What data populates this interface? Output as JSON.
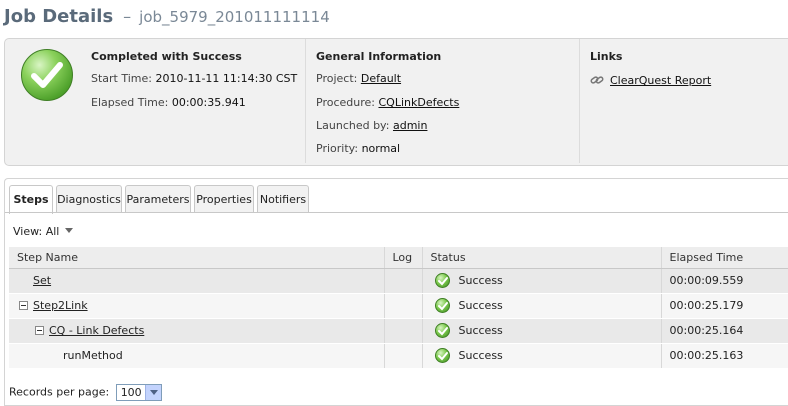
{
  "header": {
    "title": "Job Details",
    "separator": "–",
    "job_name": "job_5979_201011111114"
  },
  "summary": {
    "status_title": "Completed with Success",
    "start_label": "Start Time:",
    "start_value": "2010-11-11 11:14:30 CST",
    "elapsed_label": "Elapsed Time:",
    "elapsed_value": "00:00:35.941",
    "general_title": "General Information",
    "project_label": "Project:",
    "project_value": "Default",
    "procedure_label": "Procedure:",
    "procedure_value": "CQLinkDefects",
    "launched_label": "Launched by:",
    "launched_value": "admin",
    "priority_label": "Priority:",
    "priority_value": "normal",
    "links_title": "Links",
    "link_text": "ClearQuest Report"
  },
  "tabs": [
    "Steps",
    "Diagnostics",
    "Parameters",
    "Properties",
    "Notifiers"
  ],
  "active_tab": "Steps",
  "view": {
    "label": "View:",
    "value": "All"
  },
  "table": {
    "columns": [
      "Step Name",
      "Log",
      "Status",
      "Elapsed Time"
    ],
    "rows": [
      {
        "name": "Set",
        "log": "",
        "status": "Success",
        "elapsed": "00:00:09.559"
      },
      {
        "name": "Step2Link",
        "log": "",
        "status": "Success",
        "elapsed": "00:00:25.179"
      },
      {
        "name": "CQ - Link Defects",
        "log": "",
        "status": "Success",
        "elapsed": "00:00:25.164"
      },
      {
        "name": "runMethod",
        "log": "",
        "status": "Success",
        "elapsed": "00:00:25.163"
      }
    ]
  },
  "pagination": {
    "label": "Records per page:",
    "value": "100"
  },
  "colors": {
    "success": "#4ea12b",
    "header_text": "#5a6a7a",
    "panel_bg": "#f1f1f1"
  }
}
